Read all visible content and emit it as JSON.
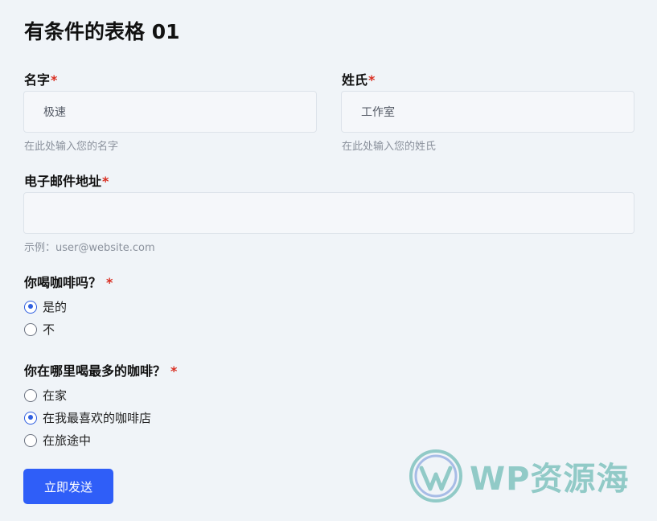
{
  "form": {
    "title": "有条件的表格 01",
    "required_mark": "*",
    "first_name": {
      "label": "名字",
      "value": "极速",
      "hint": "在此处输入您的名字"
    },
    "last_name": {
      "label": "姓氏",
      "value": "工作室",
      "hint": "在此处输入您的姓氏"
    },
    "email": {
      "label": "电子邮件地址",
      "value": "",
      "hint": "示例：user@website.com"
    },
    "coffee_question": {
      "label": "你喝咖啡吗？",
      "options": [
        {
          "label": "是的",
          "checked": true
        },
        {
          "label": "不",
          "checked": false
        }
      ]
    },
    "where_question": {
      "label": "你在哪里喝最多的咖啡？",
      "options": [
        {
          "label": "在家",
          "checked": false
        },
        {
          "label": "在我最喜欢的咖啡店",
          "checked": true
        },
        {
          "label": "在旅途中",
          "checked": false
        }
      ]
    },
    "submit_label": "立即发送"
  },
  "watermark": {
    "text": "WP资源海",
    "logo_icon": "wordpress-logo-icon"
  },
  "colors": {
    "accent": "#2f5ef8",
    "required": "#d92d20",
    "background": "#f0f4f8",
    "watermark": "#45a8a0"
  }
}
